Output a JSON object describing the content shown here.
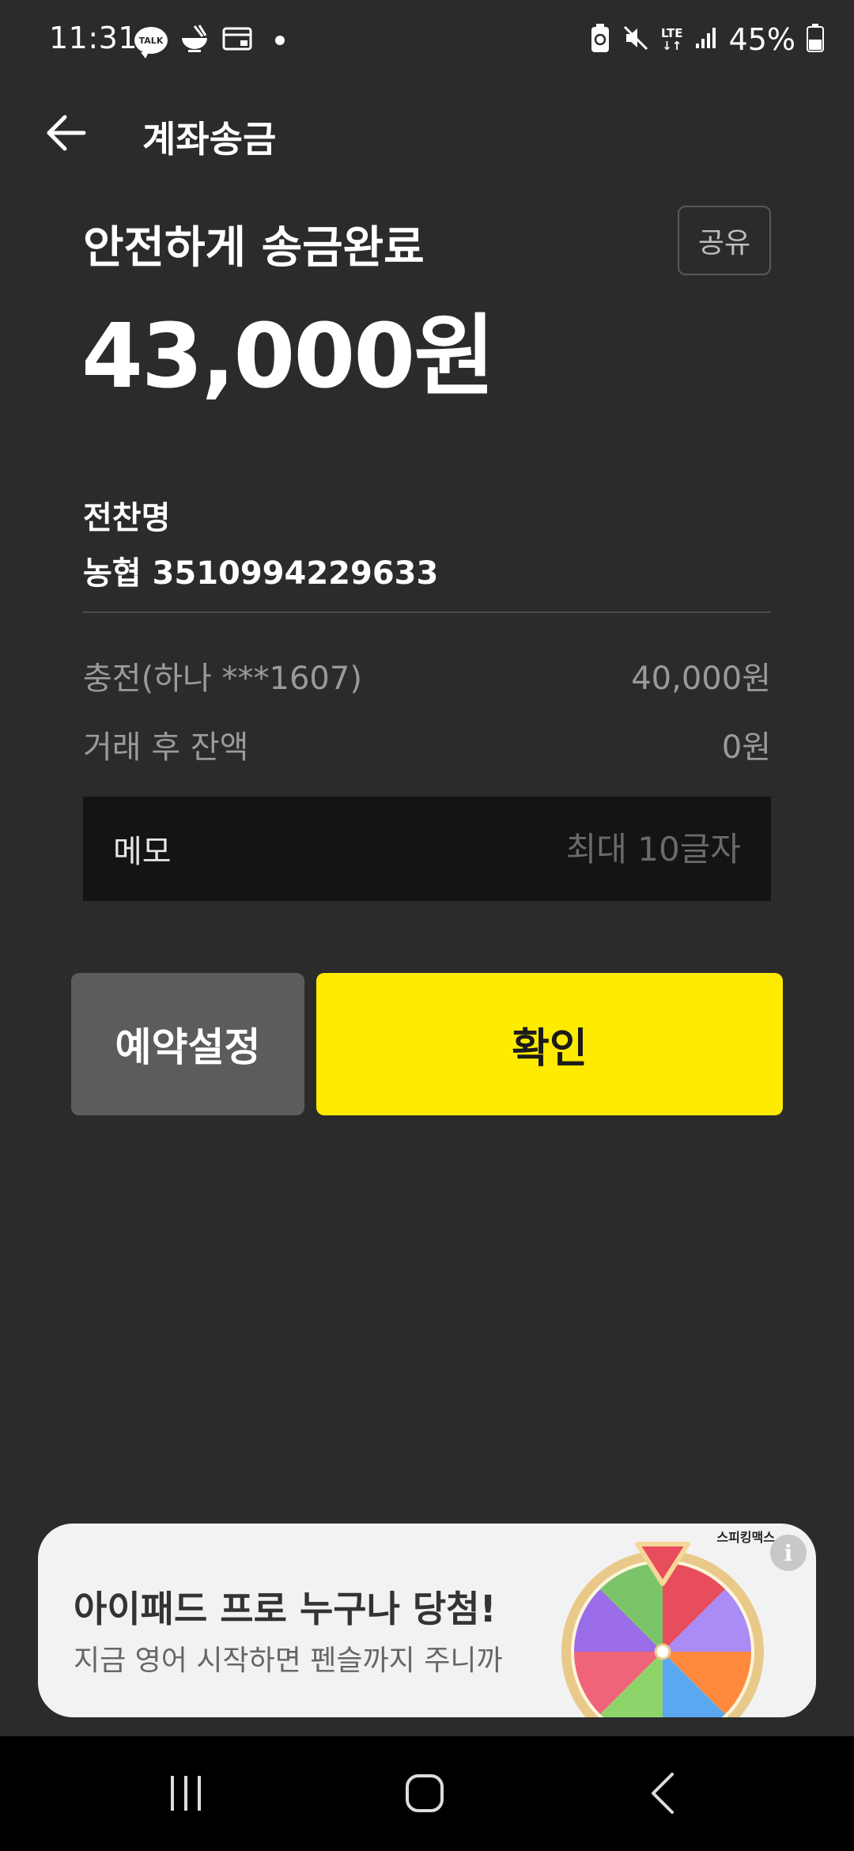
{
  "status_bar": {
    "time": "11:31",
    "talk_badge": "TALK",
    "network": "LTE",
    "battery": "45%"
  },
  "header": {
    "title": "계좌송금"
  },
  "result": {
    "subtitle": "안전하게 송금완료",
    "amount": "43,000원",
    "share_label": "공유"
  },
  "recipient": {
    "name": "전찬명",
    "account": "농협 3510994229633"
  },
  "details": {
    "charge_label": "충전(하나 ***1607)",
    "charge_value": "40,000원",
    "balance_label": "거래 후 잔액",
    "balance_value": "0원"
  },
  "memo": {
    "label": "메모",
    "value": "",
    "placeholder": "최대 10글자"
  },
  "actions": {
    "reserve_label": "예약설정",
    "confirm_label": "확인"
  },
  "ad": {
    "brand": "스피킹맥스",
    "title": "아이패드 프로 누구나 당첨!",
    "subtitle": "지금 영어 시작하면 펜슬까지 주니까",
    "info_icon": "i"
  },
  "colors": {
    "background": "#2b2b2b",
    "confirm_accent": "#ffeb00",
    "memo_background": "#141414"
  }
}
